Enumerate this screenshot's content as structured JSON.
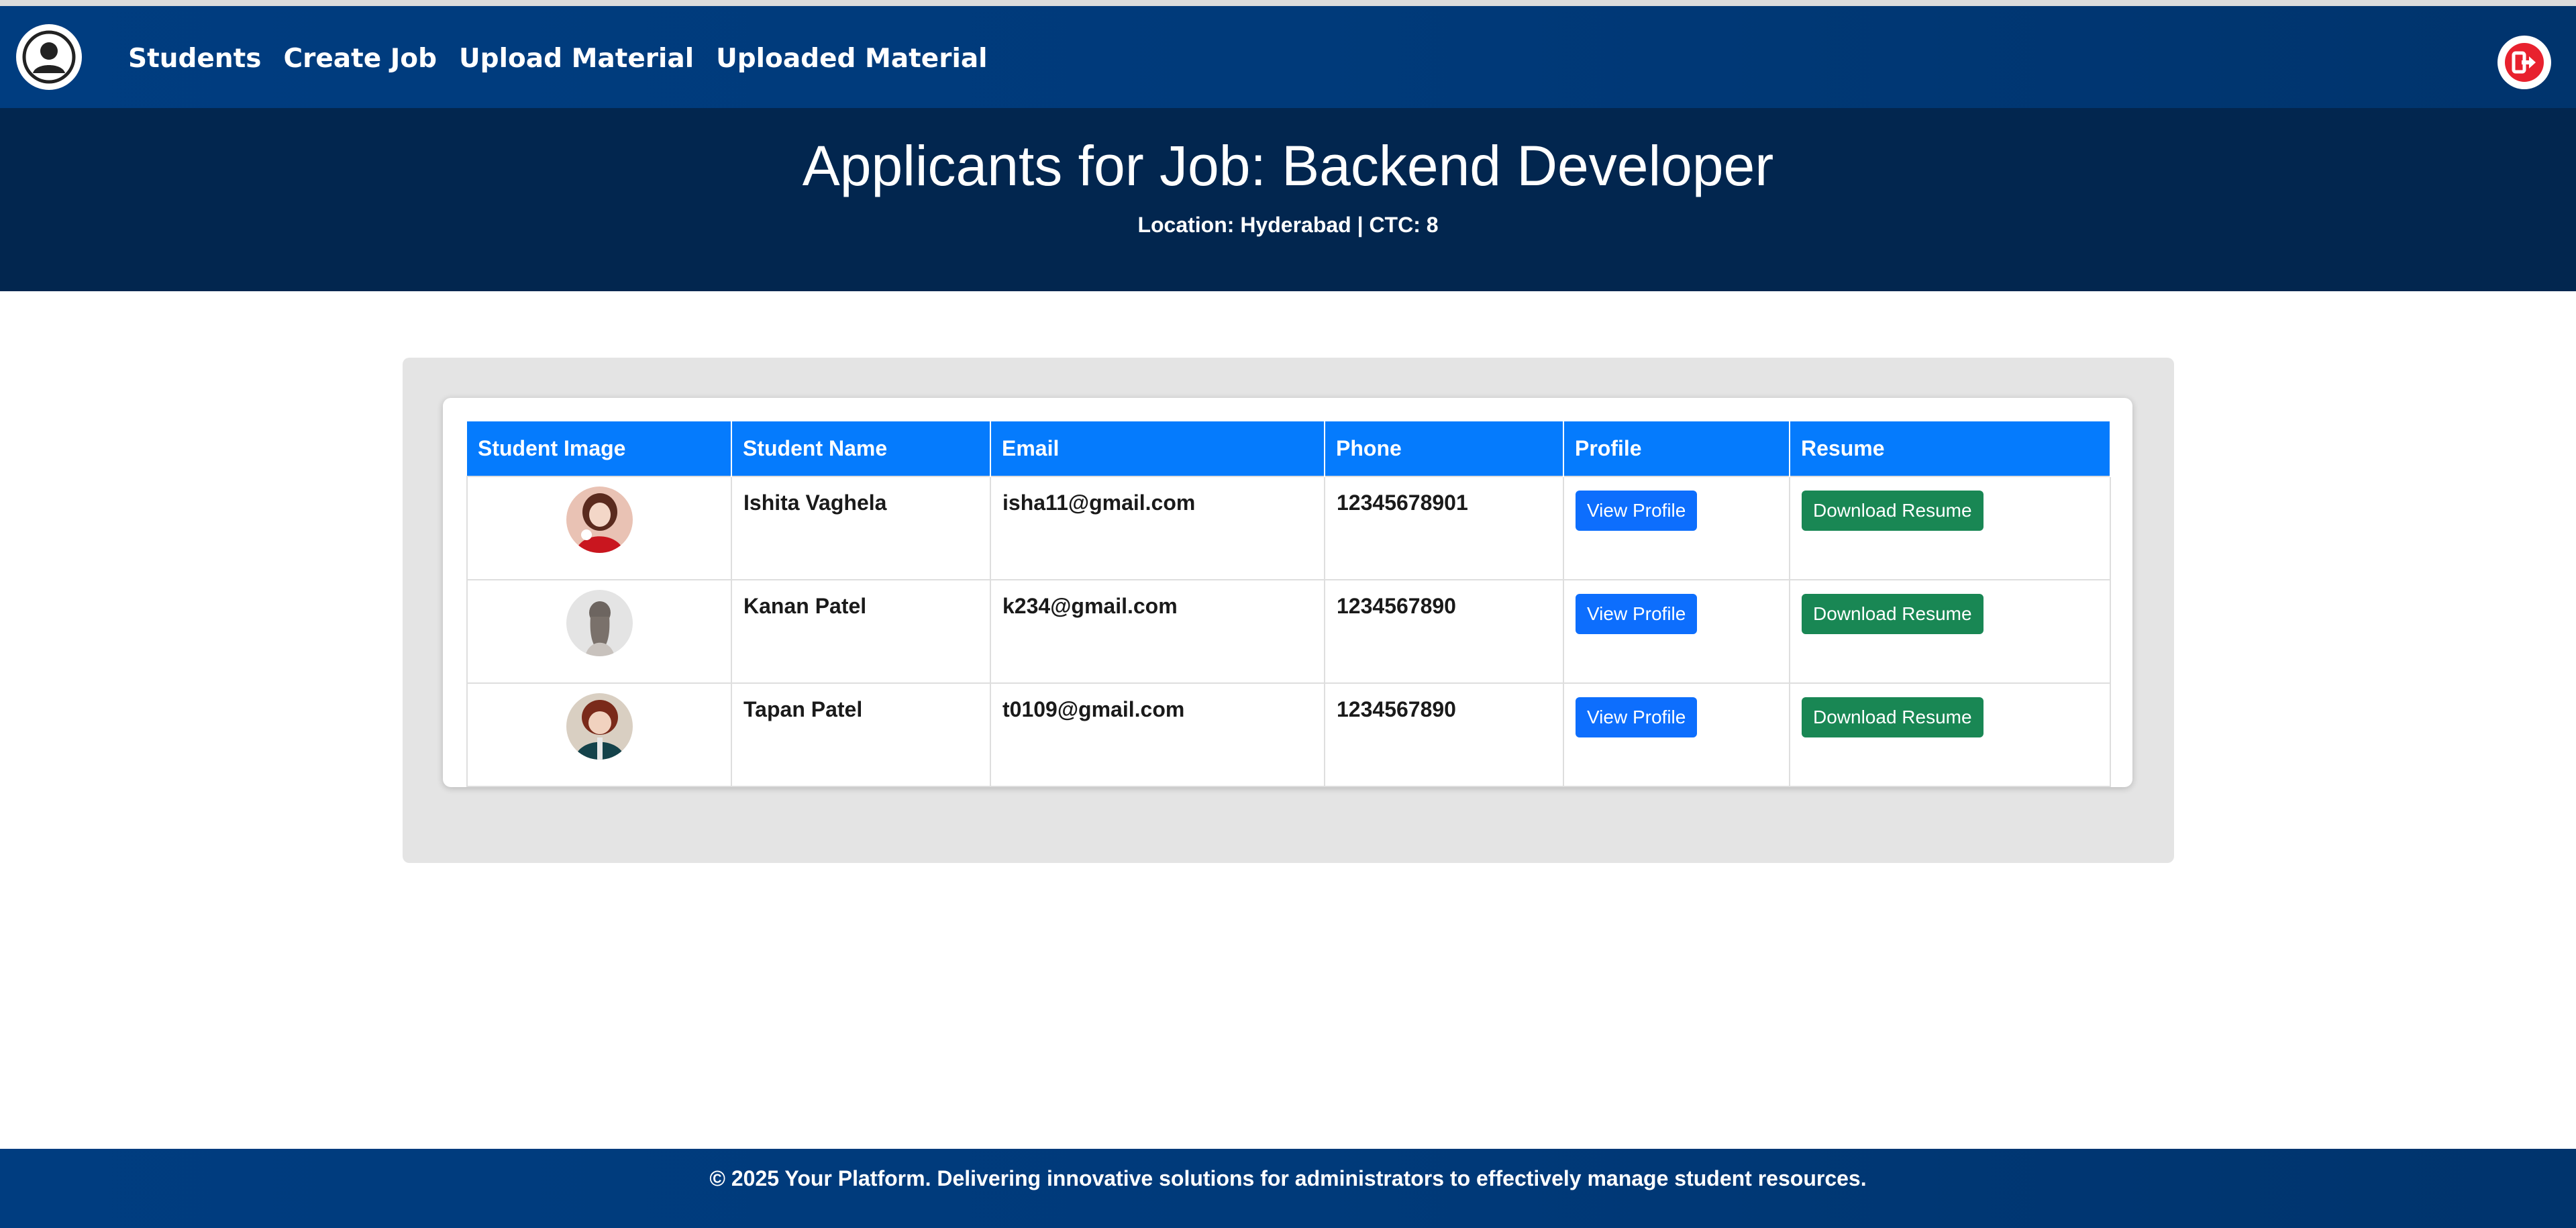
{
  "nav": {
    "links": [
      "Students",
      "Create Job",
      "Upload Material",
      "Uploaded Material"
    ],
    "avatar_icon": "user-circle-icon",
    "logout_icon": "logout-icon",
    "logout_color": "#e8212e"
  },
  "hero": {
    "title": "Applicants for Job: Backend Developer",
    "location_label": "Location:",
    "location_value": "Hyderabad",
    "separator": "|",
    "ctc_label": "CTC:",
    "ctc_value": "8"
  },
  "table": {
    "headers": [
      "Student Image",
      "Student Name",
      "Email",
      "Phone",
      "Profile",
      "Resume"
    ],
    "rows": [
      {
        "name": "Ishita Vaghela",
        "email": "isha11@gmail.com",
        "phone": "12345678901",
        "profile_btn": "View Profile",
        "resume_btn": "Download Resume"
      },
      {
        "name": "Kanan Patel",
        "email": "k234@gmail.com",
        "phone": "1234567890",
        "profile_btn": "View Profile",
        "resume_btn": "Download Resume"
      },
      {
        "name": "Tapan Patel",
        "email": "t0109@gmail.com",
        "phone": "1234567890",
        "profile_btn": "View Profile",
        "resume_btn": "Download Resume"
      }
    ]
  },
  "footer": {
    "text": "© 2025 Your Platform. Delivering innovative solutions for administrators to effectively manage student resources."
  },
  "colors": {
    "nav_bg": "#003d80",
    "hero_bg": "#02264f",
    "table_header": "#057bfd",
    "btn_primary": "#0d6efd",
    "btn_success": "#198754"
  }
}
